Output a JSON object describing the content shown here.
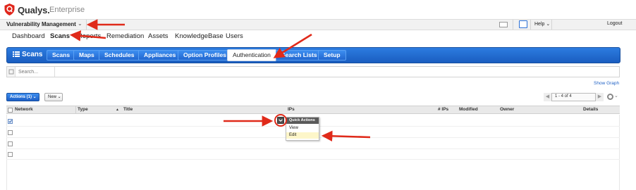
{
  "app": {
    "brand": "Qualys.",
    "edition": "Enterprise"
  },
  "module_bar": {
    "module": "Vulnerability Management",
    "help": "Help",
    "logout": "Logout"
  },
  "main_nav": [
    "Dashboard",
    "Scans",
    "Reports",
    "Remediation",
    "Assets",
    "KnowledgeBase",
    "Users"
  ],
  "section": {
    "title": "Scans"
  },
  "tabs": [
    "Scans",
    "Maps",
    "Schedules",
    "Appliances",
    "Option Profiles",
    "Authentication",
    "Search Lists",
    "Setup"
  ],
  "active_tab": "Authentication",
  "search": {
    "placeholder": "Search..."
  },
  "show_graph": "Show Graph",
  "toolbar": {
    "actions": "Actions (1)",
    "new": "New"
  },
  "pager": {
    "range": "1 - 4 of 4"
  },
  "table": {
    "columns": [
      "Network",
      "Type",
      "Title",
      "IPs",
      "# IPs",
      "Modified",
      "Owner",
      "Details"
    ],
    "row_count": 4,
    "checked_rows": [
      0
    ]
  },
  "quick_actions": {
    "header": "Quick Actions",
    "items": [
      "View",
      "Edit"
    ],
    "highlighted": "Edit"
  },
  "colors": {
    "accent": "#1a5dc0",
    "annotation": "#e02a1a",
    "highlight": "#fdf6c9"
  }
}
